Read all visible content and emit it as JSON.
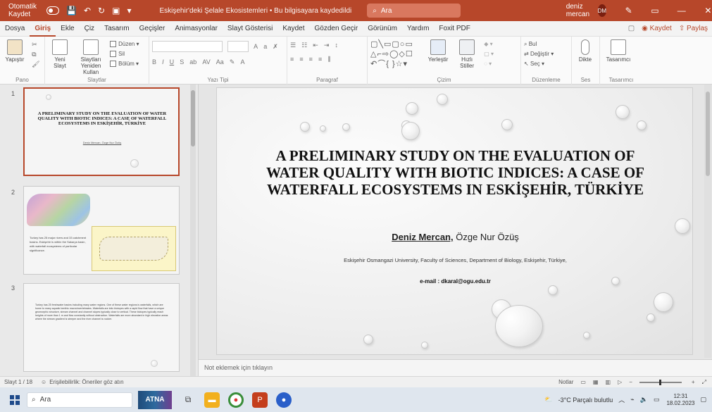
{
  "titlebar": {
    "autosave_label": "Otomatik Kaydet",
    "filename": "Eskişehir'deki Şelale Ekosistemleri • Bu bilgisayara kaydedildi",
    "search_placeholder": "Ara",
    "user_name": "deniz mercan",
    "user_initials": "DM"
  },
  "menu": {
    "tabs": [
      "Dosya",
      "Giriş",
      "Ekle",
      "Çiz",
      "Tasarım",
      "Geçişler",
      "Animasyonlar",
      "Slayt Gösterisi",
      "Kaydet",
      "Gözden Geçir",
      "Görünüm",
      "Yardım",
      "Foxit PDF"
    ],
    "save_label": "Kaydet",
    "share_label": "Paylaş"
  },
  "ribbon": {
    "paste_label": "Yapıştır",
    "new_slide_label": "Yeni Slayt",
    "reuse_label": "Slaytları Yeniden Kullan",
    "layout_label": "Düzen",
    "delete_label": "Sil",
    "section_label": "Bölüm",
    "arrange_label": "Yerleştir",
    "quick_styles_label": "Hızlı Stiller",
    "find_label": "Bul",
    "replace_label": "Değiştir",
    "select_label": "Seç",
    "dictate_label": "Dikte",
    "designer_label": "Tasarımcı",
    "groups": {
      "clipboard": "Pano",
      "slides": "Slaytlar",
      "font": "Yazı Tipi",
      "paragraph": "Paragraf",
      "drawing": "Çizim",
      "editing": "Düzenleme",
      "voice": "Ses",
      "designer": "Tasarımcı"
    }
  },
  "thumbnails": [
    {
      "number": "1",
      "title": "A PRELIMINARY STUDY ON THE EVALUATION OF WATER QUALITY WITH BIOTIC INDICES: A CASE OF WATERFALL ECOSYSTEMS IN ESKİŞEHİR, TÜRKİYE",
      "authors": "Deniz Mercan, Özge Nur Özüş"
    },
    {
      "number": "2",
      "text": "Turkey has 25 major rivers and 33 catchment basins. Eskişehir is within the Sakarya basin, with waterfall ecosystems of particular significance."
    },
    {
      "number": "3",
      "text": "Turkey has 25 freshwater basins including many water regions. One of these water regions is waterfalls, which are home to many aquatic benthic macroinvertebrates. Waterfalls are lotic biotopes with a rapid flow that have a unique geomorphic structure, stream channel and channel slopes typically close to vertical. These biotopes typically reach heights of more than 1 m and flow constantly without obstruction. Waterfalls are more abundant in high elevation areas where the stream gradient is steeper and the river channel is rockier."
    }
  ],
  "slide": {
    "title": "A PRELIMINARY STUDY ON THE EVALUATION OF WATER QUALITY WITH BIOTIC INDICES: A CASE OF WATERFALL ECOSYSTEMS IN ESKİŞEHİR, TÜRKİYE",
    "author_main": "Deniz Mercan,",
    "author_second": " Özge Nur Özüş",
    "affiliation": "Eskişehir Osmangazi University, Faculty of Sciences, Department of Biology, Eskişehir, Türkiye,",
    "email": "e-mail : dkaral@ogu.edu.tr"
  },
  "notes_placeholder": "Not eklemek için tıklayın",
  "status": {
    "slide_counter": "Slayt 1 / 18",
    "accessibility": "Erişilebilirlik: Öneriler göz atın",
    "notes_button": "Notlar"
  },
  "taskbar": {
    "search_placeholder": "Ara",
    "thumb_label": "ATNA",
    "weather": "-3°C  Parçalı bulutlu",
    "time": "12:31",
    "date": "18.02.2023"
  }
}
